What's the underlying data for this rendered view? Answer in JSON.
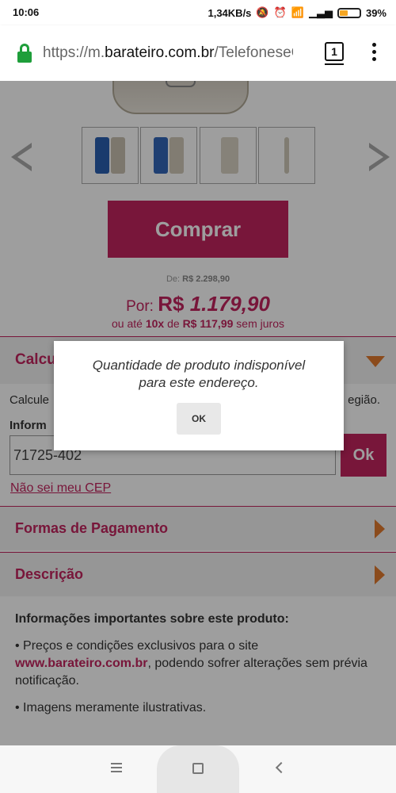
{
  "status_bar": {
    "time": "10:06",
    "network_speed": "1,34KB/s",
    "battery": "39%",
    "battery_level": 0.39,
    "icons": [
      "mute-icon",
      "alarm-icon",
      "wifi-icon",
      "signal-icon",
      "battery-icon"
    ]
  },
  "browser": {
    "url_prefix": "https://m.",
    "url_domain": "barateiro.com.br",
    "url_path": "/TelefoneseCelul",
    "tab_count": "1"
  },
  "product": {
    "buy_label": "Comprar",
    "price_from_label": "De:",
    "price_from_value": "R$ 2.298,90",
    "price_por_label": "Por:",
    "price_currency": "R$",
    "price_value": "1.179,90",
    "installments_prefix": "ou até",
    "installments_count": "10x",
    "installments_de": "de",
    "installments_value": "R$ 117,99",
    "installments_suffix": "sem juros"
  },
  "shipping": {
    "title": "Calcu",
    "description_left": "Calcule",
    "description_right": "egião.",
    "inform_label": "Inform",
    "cep_value": "71725-402",
    "ok_label": "Ok",
    "cep_link": "Não sei meu CEP"
  },
  "sections": {
    "payment_title": "Formas de Pagamento",
    "description_title": "Descrição"
  },
  "info": {
    "heading": "Informações importantes sobre este produto:",
    "bullet1_prefix": "• Preços e condições exclusivos para o site",
    "bullet1_link": "www.barateiro.com.br",
    "bullet1_suffix": ", podendo sofrer alterações sem prévia notificação.",
    "bullet2": "• Imagens meramente ilustrativas."
  },
  "dialog": {
    "message_line1": "Quantidade de produto indisponível",
    "message_line2": "para este endereço.",
    "ok_label": "OK"
  },
  "colors": {
    "brand": "#c2245e",
    "accent_arrow": "#e17a2e",
    "lock": "#1e9e3a"
  }
}
